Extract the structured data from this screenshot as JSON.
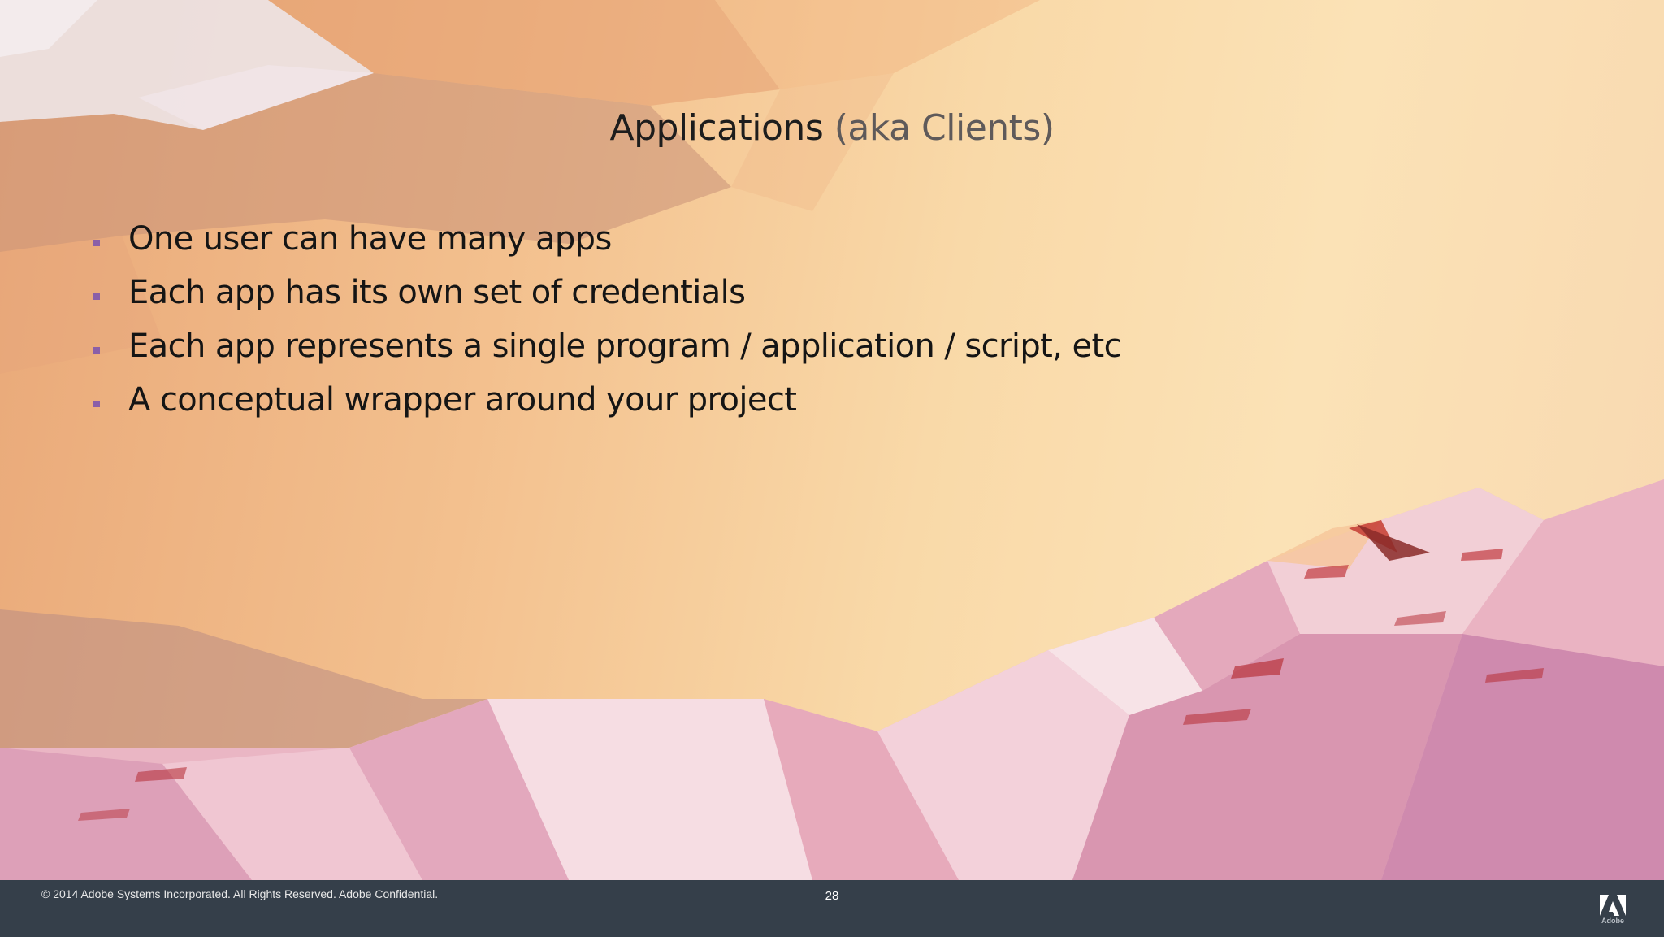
{
  "slide": {
    "title_main": "Applications",
    "title_sub": "(aka Clients)",
    "bullets": [
      "One user can have many apps",
      "Each app has its own set of credentials",
      "Each app represents a single program / application / script, etc",
      "A conceptual wrapper around your project"
    ]
  },
  "footer": {
    "copyright": "© 2014 Adobe Systems Incorporated.  All Rights Reserved.  Adobe Confidential.",
    "page_number": "28",
    "logo_text": "Adobe"
  },
  "colors": {
    "footer_bg": "#353f4a",
    "bullet": "#8a5fa8",
    "title": "#1d1d1d",
    "title_sub": "#5f5a5a"
  },
  "icons": {
    "bullet": "square-bullet-icon",
    "logo": "adobe-logo-icon"
  }
}
